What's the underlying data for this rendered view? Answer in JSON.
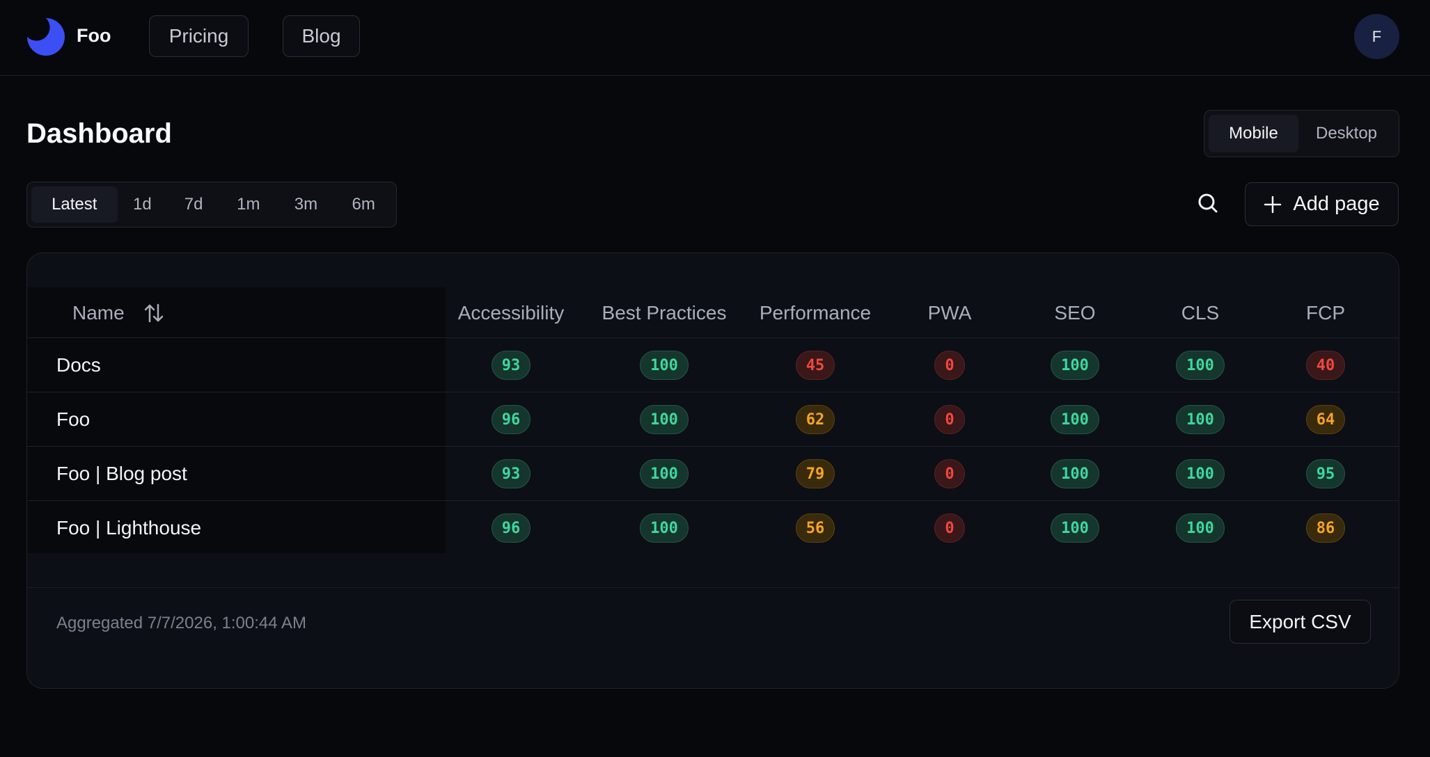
{
  "header": {
    "brand": "Foo",
    "nav": {
      "pricing": "Pricing",
      "blog": "Blog"
    },
    "avatar_initial": "F"
  },
  "page": {
    "title": "Dashboard",
    "device_toggle": {
      "mobile": "Mobile",
      "desktop": "Desktop",
      "selected": "Mobile"
    },
    "ranges": [
      "Latest",
      "1d",
      "7d",
      "1m",
      "3m",
      "6m"
    ],
    "selected_range": "Latest",
    "add_page_label": "Add page"
  },
  "table": {
    "name_header": "Name",
    "columns": [
      "Accessibility",
      "Best Practices",
      "Performance",
      "PWA",
      "SEO",
      "CLS",
      "FCP"
    ],
    "rows": [
      {
        "name": "Docs",
        "scores": [
          "93",
          "100",
          "45",
          "0",
          "100",
          "100",
          "40"
        ]
      },
      {
        "name": "Foo",
        "scores": [
          "96",
          "100",
          "62",
          "0",
          "100",
          "100",
          "64"
        ]
      },
      {
        "name": "Foo | Blog post",
        "scores": [
          "93",
          "100",
          "79",
          "0",
          "100",
          "100",
          "95"
        ]
      },
      {
        "name": "Foo | Lighthouse",
        "scores": [
          "96",
          "100",
          "56",
          "0",
          "100",
          "100",
          "86"
        ]
      }
    ]
  },
  "footer": {
    "aggregated": "Aggregated 7/7/2026, 1:00:44 AM",
    "export_label": "Export CSV"
  },
  "colors": {
    "accent": "#3b4ff5",
    "good": "#3fd6a0",
    "average": "#f5a524",
    "poor": "#f0483e"
  }
}
